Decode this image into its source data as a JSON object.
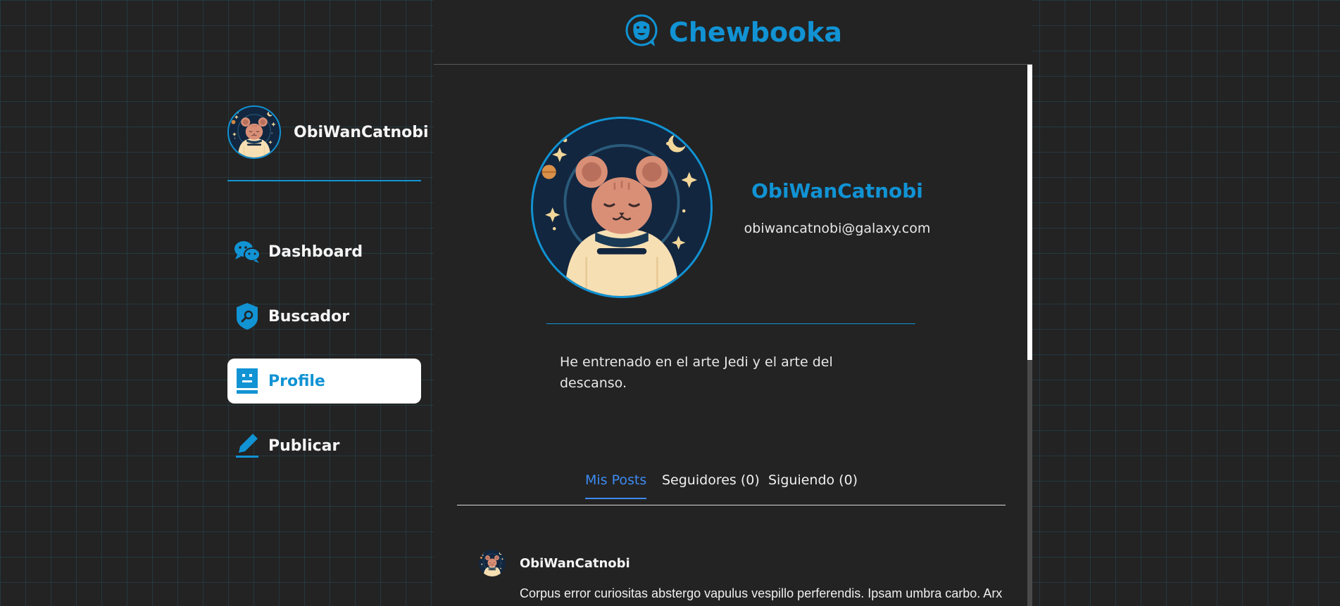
{
  "app": {
    "brand": "Chewbooka",
    "brand_icon": "wookiee-logo-icon",
    "accent_color": "#1193d4"
  },
  "sidebar": {
    "username": "ObiWanCatnobi",
    "items": [
      {
        "label": "Dashboard",
        "icon": "chat-bubbles-icon",
        "active": false
      },
      {
        "label": "Buscador",
        "icon": "search-shield-icon",
        "active": false
      },
      {
        "label": "Profile",
        "icon": "robot-profile-icon",
        "active": true
      },
      {
        "label": "Publicar",
        "icon": "pencil-icon",
        "active": false
      }
    ]
  },
  "profile": {
    "name": "ObiWanCatnobi",
    "email": "obiwancatnobi@galaxy.com",
    "bio": "He entrenado en el arte Jedi y el arte del descanso."
  },
  "tabs": [
    {
      "label": "Mis Posts",
      "active": true
    },
    {
      "label": "Seguidores (0)",
      "active": false
    },
    {
      "label": "Siguiendo (0)",
      "active": false
    }
  ],
  "posts": [
    {
      "author": "ObiWanCatnobi",
      "text": "Corpus error curiositas abstergo vapulus vespillo perferendis. Ipsam umbra carbo. Arx"
    }
  ]
}
